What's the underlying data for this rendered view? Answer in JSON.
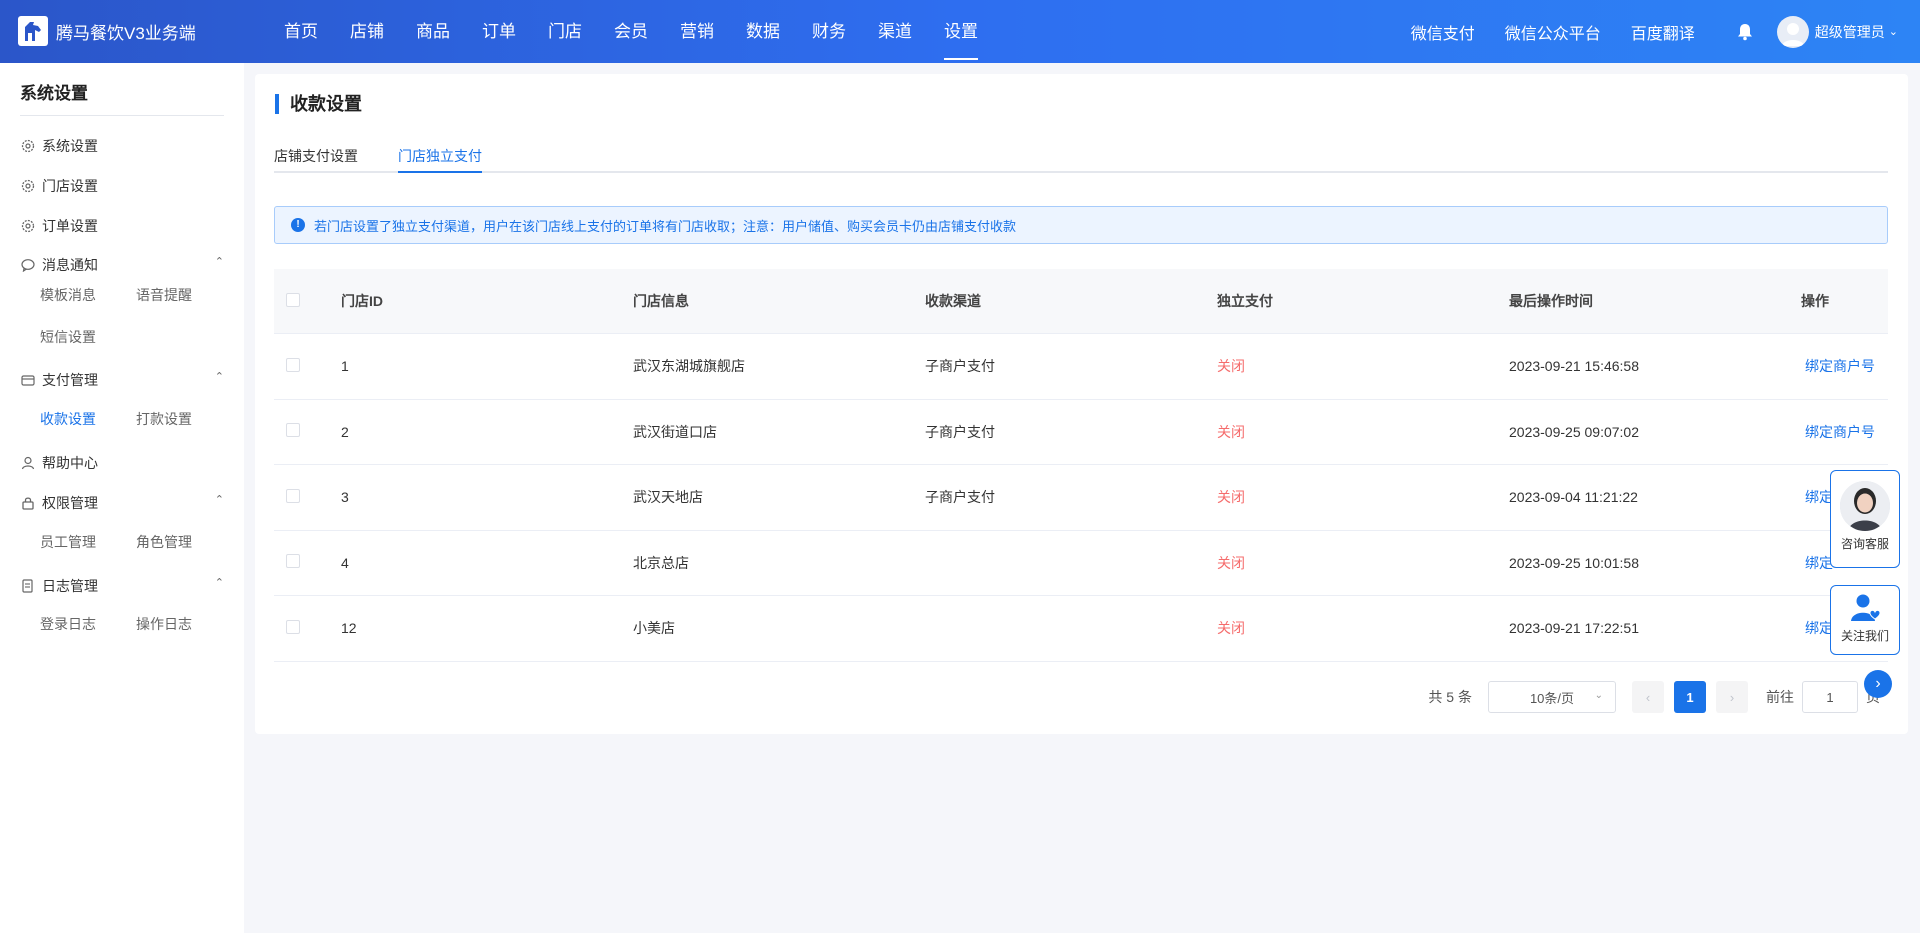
{
  "header": {
    "brand": "腾马餐饮V3业务端",
    "nav": [
      "首页",
      "店铺",
      "商品",
      "订单",
      "门店",
      "会员",
      "营销",
      "数据",
      "财务",
      "渠道",
      "设置"
    ],
    "active_nav": "设置",
    "right_links": [
      "微信支付",
      "微信公众平台",
      "百度翻译"
    ],
    "user": "超级管理员"
  },
  "sidebar": {
    "title": "系统设置",
    "items": [
      {
        "label": "系统设置",
        "icon": "gear-icon"
      },
      {
        "label": "门店设置",
        "icon": "gear-icon"
      },
      {
        "label": "订单设置",
        "icon": "gear-icon"
      },
      {
        "label": "消息通知",
        "icon": "message-icon",
        "children": [
          "模板消息",
          "语音提醒",
          "短信设置"
        ]
      },
      {
        "label": "支付管理",
        "icon": "wallet-icon",
        "children": [
          "收款设置",
          "打款设置"
        ]
      },
      {
        "label": "帮助中心",
        "icon": "user-icon"
      },
      {
        "label": "权限管理",
        "icon": "lock-icon",
        "children": [
          "员工管理",
          "角色管理"
        ]
      },
      {
        "label": "日志管理",
        "icon": "log-icon",
        "children": [
          "登录日志",
          "操作日志"
        ]
      }
    ],
    "active_sub": "收款设置"
  },
  "main": {
    "title": "收款设置",
    "tabs": [
      "店铺支付设置",
      "门店独立支付"
    ],
    "active_tab": "门店独立支付",
    "alert": "若门店设置了独立支付渠道，用户在该门店线上支付的订单将有门店收取；注意：用户储值、购买会员卡仍由店铺支付收款",
    "table": {
      "columns": [
        "门店ID",
        "门店信息",
        "收款渠道",
        "独立支付",
        "最后操作时间",
        "操作"
      ],
      "rows": [
        {
          "id": "1",
          "info": "武汉东湖城旗舰店",
          "channel": "子商户支付",
          "status": "关闭",
          "time": "2023-09-21 15:46:58",
          "op": "绑定商户号"
        },
        {
          "id": "2",
          "info": "武汉街道口店",
          "channel": "子商户支付",
          "status": "关闭",
          "time": "2023-09-25 09:07:02",
          "op": "绑定商户号"
        },
        {
          "id": "3",
          "info": "武汉天地店",
          "channel": "子商户支付",
          "status": "关闭",
          "time": "2023-09-04 11:21:22",
          "op": "绑定"
        },
        {
          "id": "4",
          "info": "北京总店",
          "channel": "",
          "status": "关闭",
          "time": "2023-09-25 10:01:58",
          "op": "绑定"
        },
        {
          "id": "12",
          "info": "小美店",
          "channel": "",
          "status": "关闭",
          "time": "2023-09-21 17:22:51",
          "op": "绑定"
        }
      ]
    },
    "pagination": {
      "total": "共 5 条",
      "page_size": "10条/页",
      "current": "1",
      "goto_label": "前往",
      "goto_value": "1",
      "page_suffix": "页"
    }
  },
  "float": {
    "service": "咨询客服",
    "follow": "关注我们"
  },
  "colors": {
    "accent": "#1a73e8",
    "header_start": "#2b56c9",
    "header_end": "#2d84f5",
    "status_off": "#f56c6c"
  }
}
